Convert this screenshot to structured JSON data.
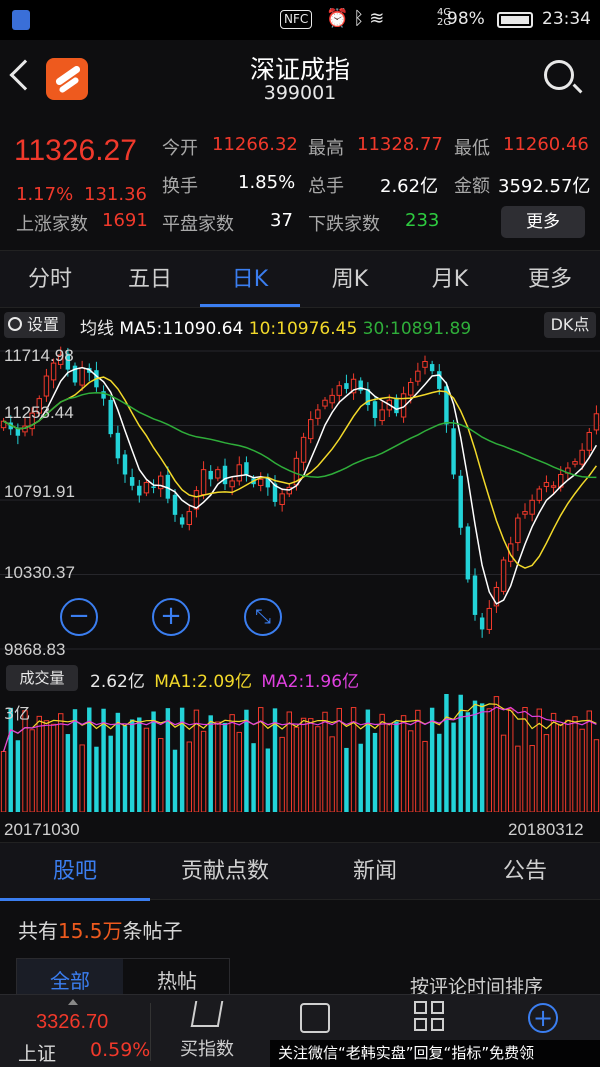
{
  "status_bar": {
    "nfc": "NFC",
    "network": "4G\n2G",
    "battery": "98%",
    "time": "23:34"
  },
  "header": {
    "title": "深证成指",
    "code": "399001"
  },
  "quote": {
    "last": "11326.27",
    "change_pct": "1.17%",
    "change": "131.36",
    "open_label": "今开",
    "open": "11266.32",
    "high_label": "最高",
    "high": "11328.77",
    "low_label": "最低",
    "low": "11260.46",
    "turnover_label": "换手",
    "turnover": "1.85%",
    "volume_label": "总手",
    "volume": "2.62亿",
    "amount_label": "金额",
    "amount": "3592.57亿",
    "up_label": "上涨家数",
    "up": "1691",
    "flat_label": "平盘家数",
    "flat": "37",
    "down_label": "下跌家数",
    "down": "233",
    "more": "更多"
  },
  "period_tabs": [
    "分时",
    "五日",
    "日K",
    "周K",
    "月K",
    "更多"
  ],
  "ma_bar": {
    "settings": "设置",
    "label": "均线",
    "ma5": "MA5:11090.64",
    "ma10": "10:10976.45",
    "ma30": "30:10891.89",
    "dk": "DK点"
  },
  "chart_data": {
    "type": "candlestick",
    "y_ticks": [
      "11714.98",
      "11253.44",
      "10791.91",
      "10330.37",
      "9868.83"
    ],
    "ylim": [
      9868.83,
      11714.98
    ],
    "x_start": "20171030",
    "x_end": "20180312",
    "closes": [
      11280,
      11230,
      11190,
      11250,
      11330,
      11420,
      11560,
      11640,
      11690,
      11600,
      11520,
      11610,
      11580,
      11490,
      11420,
      11200,
      11050,
      10950,
      10880,
      10820,
      10900,
      10870,
      10940,
      10800,
      10700,
      10640,
      10720,
      10850,
      10980,
      10920,
      10980,
      10890,
      10910,
      11010,
      10950,
      10890,
      10920,
      10870,
      10780,
      10830,
      10870,
      11050,
      11180,
      11290,
      11350,
      11410,
      11440,
      11500,
      11480,
      11540,
      11470,
      11380,
      11300,
      11350,
      11410,
      11330,
      11450,
      11520,
      11590,
      11650,
      11590,
      11480,
      11260,
      10950,
      10620,
      10300,
      10080,
      9990,
      10120,
      10250,
      10420,
      10520,
      10680,
      10720,
      10790,
      10860,
      10900,
      10880,
      10950,
      10990,
      11030,
      11100,
      11210,
      11326
    ],
    "ma_series": [
      {
        "name": "MA5",
        "color": "#ffffff"
      },
      {
        "name": "MA10",
        "color": "#f2d92a"
      },
      {
        "name": "MA30",
        "color": "#2fae3a"
      }
    ],
    "up_color": "#f0392b",
    "down_color": "#23d3d8"
  },
  "zoom": {
    "minus": "−",
    "plus": "+"
  },
  "volume_bar": {
    "button": "成交量",
    "value": "2.62亿",
    "ma1": "MA1:2.09亿",
    "ma2": "MA2:1.96亿",
    "y_tick": "3亿",
    "ma1_color": "#f2d92a",
    "ma2_color": "#e040e0"
  },
  "info_tabs": [
    "股吧",
    "贡献点数",
    "新闻",
    "公告"
  ],
  "posts": {
    "prefix": "共有",
    "count": "15.5万",
    "suffix": "条帖子",
    "filter_all": "全部",
    "filter_hot": "热帖",
    "sort": "按评论时间排序"
  },
  "bottom_bar": {
    "price": "3326.70",
    "name": "上证",
    "pct": "0.59%",
    "buy": "买指数"
  },
  "watermark": "关注微信“老韩实盘”回复“指标”免费领"
}
